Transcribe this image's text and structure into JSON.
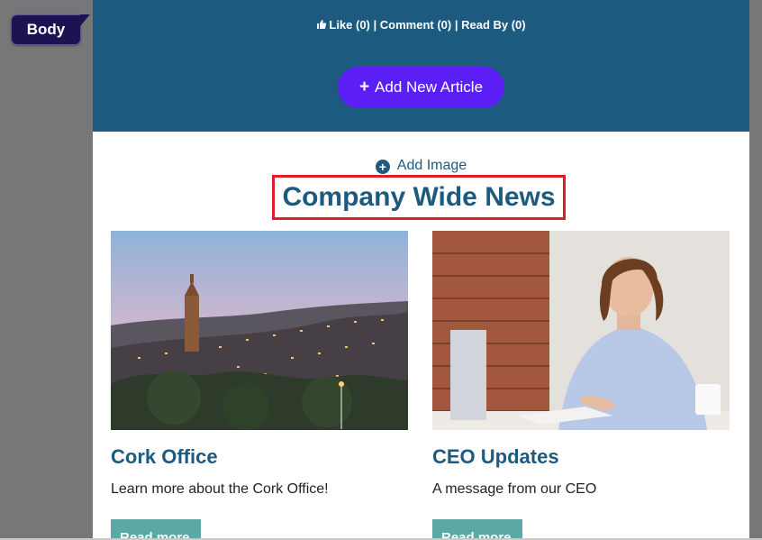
{
  "editor": {
    "body_tag": "Body"
  },
  "social": {
    "like": "Like (0)",
    "sep1": " | ",
    "comment": "Comment (0)",
    "sep2": " | ",
    "read_by": "Read By (0)"
  },
  "actions": {
    "add_article_label": "Add New Article",
    "add_image_label": "Add Image"
  },
  "section": {
    "title": "Company Wide News"
  },
  "cards": [
    {
      "title": "Cork Office",
      "description": "Learn more about the Cork Office!",
      "button": "Read more"
    },
    {
      "title": "CEO Updates",
      "description": "A message from our CEO",
      "button": "Read more"
    }
  ],
  "colors": {
    "band": "#1d5a7f",
    "button": "#5b1ef5",
    "accent": "#1d5a7f",
    "highlight": "#e01e2a",
    "read_more": "#5ba8a6"
  }
}
